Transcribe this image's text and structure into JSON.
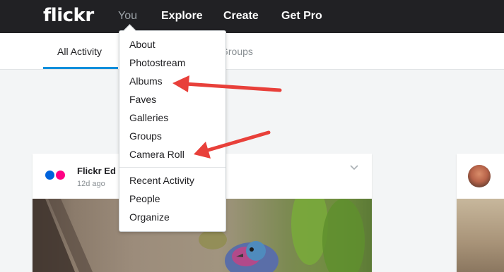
{
  "header": {
    "logo": "flickr",
    "nav": [
      {
        "label": "You",
        "state": "open"
      },
      {
        "label": "Explore"
      },
      {
        "label": "Create"
      },
      {
        "label": "Get Pro"
      }
    ]
  },
  "subnav": {
    "tabs": [
      {
        "label": "All Activity",
        "active": true
      },
      {
        "label": "Groups",
        "active": false
      }
    ]
  },
  "dropdown": {
    "items_top": [
      "About",
      "Photostream",
      "Albums",
      "Faves",
      "Galleries",
      "Groups",
      "Camera Roll"
    ],
    "items_bottom": [
      "Recent Activity",
      "People",
      "Organize"
    ]
  },
  "feed": {
    "card1": {
      "title": "Flickr Ed",
      "time": "12d ago",
      "menu_icon": "chevron-down-icon"
    },
    "card2": {
      "avatar": "avatar"
    }
  },
  "annotations": {
    "arrow_color": "#e8403a",
    "pointing_to": [
      "Albums",
      "Camera Roll"
    ]
  },
  "colors": {
    "topbar": "#212124",
    "accent": "#128fdc",
    "flickr_blue": "#0063dc",
    "flickr_pink": "#ff0084"
  }
}
